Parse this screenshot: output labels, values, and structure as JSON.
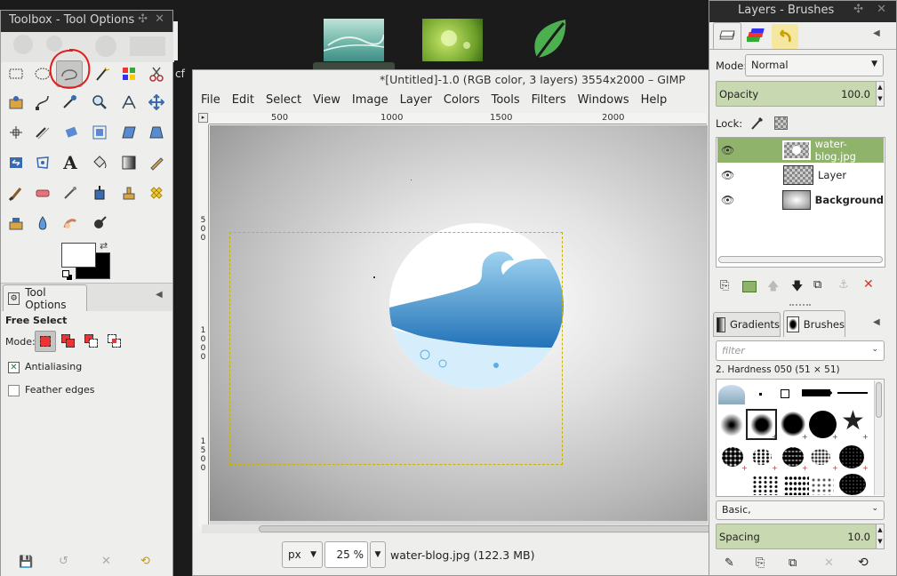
{
  "desktop": {
    "thumbs": [
      "water-thumbnail",
      "leaf-drop-thumbnail",
      "leaf-logo"
    ],
    "left_glyph": "cf"
  },
  "toolbox": {
    "title": "Toolbox - Tool Options",
    "tool_options_tab": "Tool Options",
    "tool_name": "Free Select",
    "mode_label": "Mode:",
    "antialiasing": "Antialiasing",
    "feather": "Feather edges",
    "fg_color": "#ffffff",
    "bg_color": "#000000"
  },
  "main": {
    "title": "*[Untitled]-1.0 (RGB color, 3 layers) 3554x2000 – GIMP",
    "menu": [
      "File",
      "Edit",
      "Select",
      "View",
      "Image",
      "Layer",
      "Colors",
      "Tools",
      "Filters",
      "Windows",
      "Help"
    ],
    "ruler_h": [
      "500",
      "1000",
      "1500",
      "2000"
    ],
    "ruler_v": [
      "500",
      "1000",
      "1500"
    ],
    "unit": "px",
    "zoom": "25 %",
    "status": "water-blog.jpg (122.3 MB)"
  },
  "layers": {
    "title": "Layers - Brushes",
    "mode_label": "Mode:",
    "mode": "Normal",
    "opacity_label": "Opacity",
    "opacity": "100.0",
    "lock_label": "Lock:",
    "items": [
      {
        "name": "water-blog.jpg",
        "selected": true
      },
      {
        "name": "Layer",
        "selected": false
      },
      {
        "name": "Background",
        "selected": false
      }
    ]
  },
  "brushes": {
    "tabs": [
      "Gradients",
      "Brushes"
    ],
    "filter_placeholder": "filter",
    "brush_name": "2. Hardness 050 (51 × 51)",
    "preset": "Basic,",
    "spacing_label": "Spacing",
    "spacing": "10.0"
  }
}
